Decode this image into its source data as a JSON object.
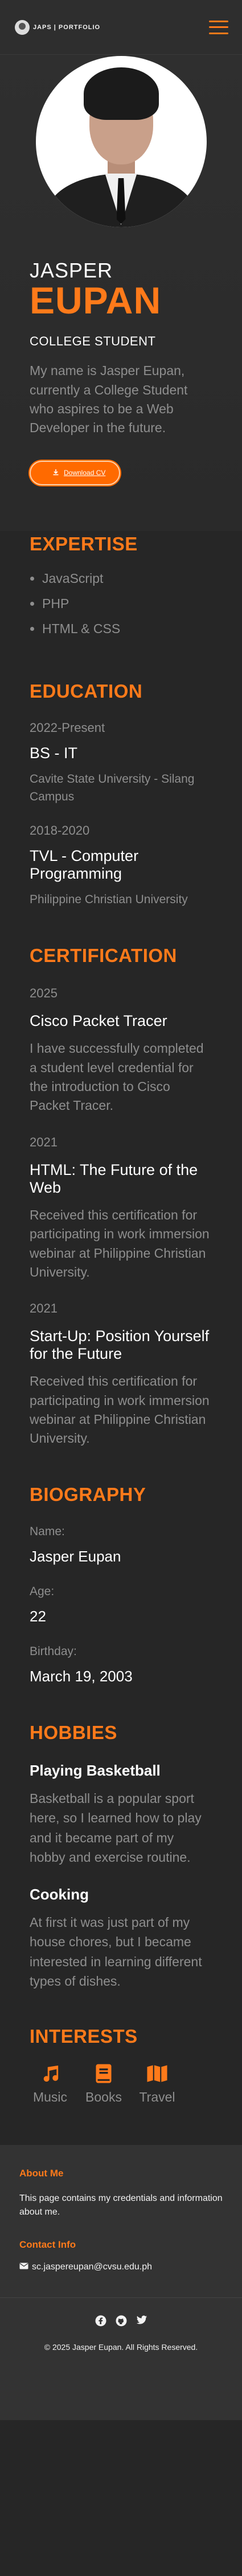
{
  "navbar": {
    "logo_text": "JAPS | PORTFOLIO"
  },
  "hero": {
    "first_name": "JASPER",
    "last_name": "EUPAN",
    "role": "COLLEGE STUDENT",
    "intro": "My name is Jasper Eupan, currently a College Student who aspires to be a Web Developer in the future.",
    "download_label": "Download CV"
  },
  "expertise": {
    "title": "EXPERTISE",
    "items": [
      "JavaScript",
      "PHP",
      "HTML & CSS"
    ]
  },
  "education": {
    "title": "EDUCATION",
    "items": [
      {
        "year": "2022-Present",
        "degree": "BS - IT",
        "school": "Cavite State University - Silang Campus"
      },
      {
        "year": "2018-2020",
        "degree": "TVL - Computer Programming",
        "school": "Philippine Christian University"
      }
    ]
  },
  "certification": {
    "title": "CERTIFICATION",
    "items": [
      {
        "year": "2025",
        "name": "Cisco Packet Tracer",
        "desc": "I have successfully completed a student level credential for the introduction to Cisco Packet Tracer."
      },
      {
        "year": "2021",
        "name": "HTML: The Future of the Web",
        "desc": "Received this certification for participating in work immersion webinar at Philippine Christian University."
      },
      {
        "year": "2021",
        "name": "Start-Up: Position Yourself for the Future",
        "desc": "Received this certification for participating in work immersion webinar at Philippine Christian University."
      }
    ]
  },
  "biography": {
    "title": "BIOGRAPHY",
    "fields": [
      {
        "label": "Name:",
        "value": "Jasper Eupan"
      },
      {
        "label": "Age:",
        "value": "22"
      },
      {
        "label": "Birthday:",
        "value": "March 19, 2003"
      }
    ]
  },
  "hobbies": {
    "title": "HOBBIES",
    "items": [
      {
        "name": "Playing Basketball",
        "desc": "Basketball is a popular sport here, so I learned how to play and it became part of my hobby and exercise routine."
      },
      {
        "name": "Cooking",
        "desc": "At first it was just part of my house chores, but I became interested in learning different types of dishes."
      }
    ]
  },
  "interests": {
    "title": "INTERESTS",
    "items": [
      {
        "label": "Music",
        "icon": "music-icon"
      },
      {
        "label": "Books",
        "icon": "book-icon"
      },
      {
        "label": "Travel",
        "icon": "map-icon"
      }
    ]
  },
  "footer": {
    "about_title": "About Me",
    "about_text": "This page contains my credentials and information about me.",
    "contact_title": "Contact Info",
    "email": "sc.jaspereupan@cvsu.edu.ph",
    "socials": [
      "facebook-icon",
      "github-icon",
      "twitter-icon"
    ],
    "copyright": "© 2025 Jasper Eupan. All Rights Reserved."
  },
  "colors": {
    "accent": "#ff7a1a",
    "background": "#262626",
    "muted": "#8e8e8e",
    "footer": "#333333"
  }
}
